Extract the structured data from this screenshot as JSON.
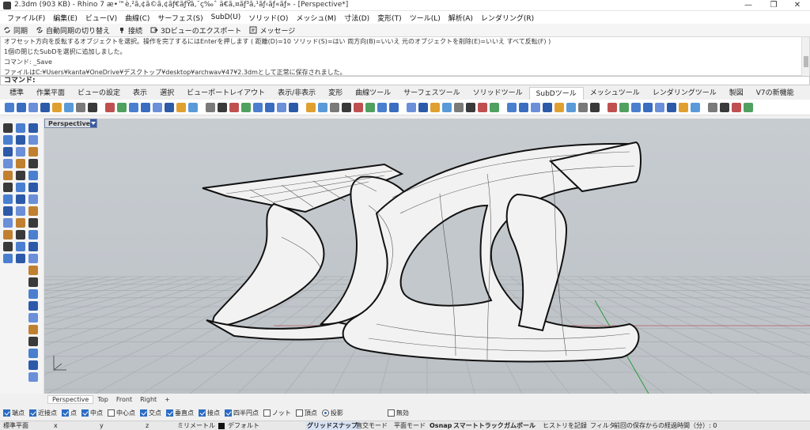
{
  "window": {
    "title": "2.3dm (903 KB) - Rhino 7 æ•™è‚²ã‚¢ã©ã‚¢ãƒ€ãƒŸã‚¯ç‰ˆ ã€ã‚¤ãƒ³ã‚¹ãƒ‹ãƒ«ãƒ» - [Perspective*]",
    "minimize": "—",
    "maximize": "❐",
    "close": "✕"
  },
  "menu": [
    "ファイル(F)",
    "編集(E)",
    "ビュー(V)",
    "曲線(C)",
    "サーフェス(S)",
    "SubD(U)",
    "ソリッド(O)",
    "メッシュ(M)",
    "寸法(D)",
    "変形(T)",
    "ツール(L)",
    "解析(A)",
    "レンダリング(R)"
  ],
  "toolbar1": {
    "sync": "同期",
    "auto_sync": "自動同期の切り替え",
    "connect": "接続",
    "export3d": "3Dビューのエクスポート",
    "message": "メッセージ"
  },
  "command_history": [
    "オフセット方向を反転するオブジェクトを選択。操作を完了するにはEnterを押します ( 距離(D)=10  ソリッド(S)=はい  両方向(B)=いいえ  元のオブジェクトを削除(E)=いいえ  すべて反転(F) )",
    "1個の閉じたSubDを選択に追加しました。",
    "コマンド: _Save",
    "ファイルはC:¥Users¥kanta¥OneDrive¥デスクトップ¥desktop¥archwav¥47¥2.3dmとして正常に保存されました。"
  ],
  "command_prompt": "コマンド:",
  "tabs": [
    "標準",
    "作業平面",
    "ビューの設定",
    "表示",
    "選択",
    "ビューポートレイアウト",
    "表示/非表示",
    "変形",
    "曲線ツール",
    "サーフェスツール",
    "ソリッドツール",
    "SubDツール",
    "メッシュツール",
    "レンダリングツール",
    "製図",
    "V7の新機能"
  ],
  "active_tab": "SubDツール",
  "viewport": {
    "name": "Perspective*"
  },
  "viewport_tabs": [
    "Perspective",
    "Top",
    "Front",
    "Right",
    "+"
  ],
  "osnap": [
    {
      "label": "端点",
      "checked": true
    },
    {
      "label": "近接点",
      "checked": true
    },
    {
      "label": "点",
      "checked": true
    },
    {
      "label": "中点",
      "checked": true
    },
    {
      "label": "中心点",
      "checked": false
    },
    {
      "label": "交点",
      "checked": true
    },
    {
      "label": "垂直点",
      "checked": true
    },
    {
      "label": "接点",
      "checked": true
    },
    {
      "label": "四半円点",
      "checked": true
    },
    {
      "label": "ノット",
      "checked": false
    },
    {
      "label": "頂点",
      "checked": false
    },
    {
      "label": "投影",
      "checked": true,
      "radio": true
    },
    {
      "label": "無効",
      "checked": false
    }
  ],
  "status": {
    "plane": "標準平面",
    "x": "x",
    "y": "y",
    "z": "z",
    "units": "ミリメートル",
    "layer": "デフォルト",
    "grid_snap": "グリッドスナップ",
    "ortho": "直交モード",
    "planar": "平面モード",
    "osnap": "Osnap",
    "smart_track": "スマートトラック",
    "gumball": "ガムボール",
    "history": "ヒストリを記録",
    "filter": "フィルタ",
    "since_save": "前回の保存からの経過時間（分）: 0"
  },
  "colors": {
    "accent": "#2b6cc4",
    "viewport_bg": "#c3c8cd",
    "model_fill": "#f2f2f2",
    "model_outline": "#111111",
    "grid_line": "#a3a8ad",
    "x_axis": "#b03030",
    "y_axis": "#2a9a3a"
  }
}
